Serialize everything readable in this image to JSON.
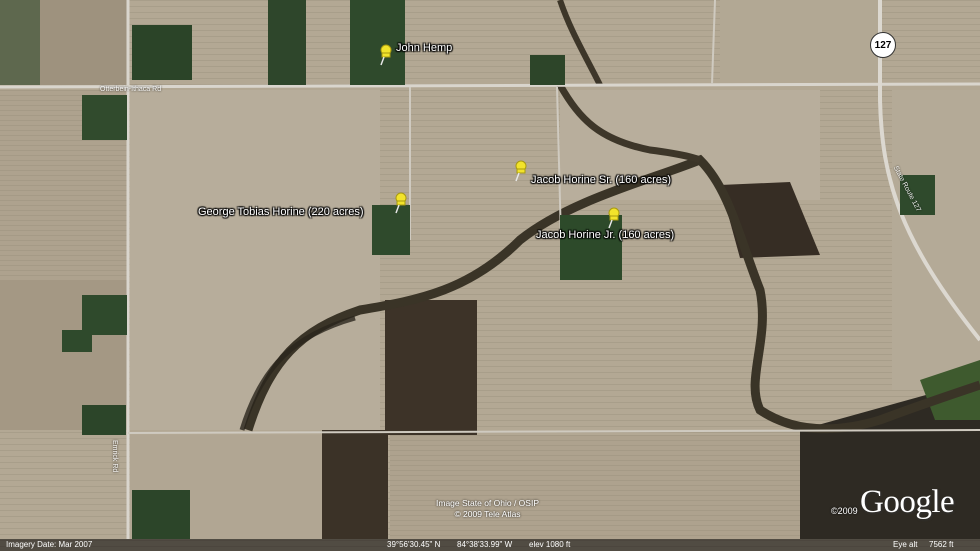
{
  "markers": [
    {
      "label": "John Hemp"
    },
    {
      "label": "Jacob Horine Sr. (160 acres)"
    },
    {
      "label": "George Tobias Horine (220 acres)"
    },
    {
      "label": "Jacob Horine Jr. (160 acres)"
    }
  ],
  "roads": {
    "highway_shield": "127",
    "road_a": "Otterbein-Ithaca Rd",
    "road_b": "Emrick Rd",
    "road_c": "State Route 127"
  },
  "credits": {
    "line1": "Image State of Ohio / OSIP",
    "line2": "© 2009 Tele Atlas",
    "logo": "Google",
    "copyright": "©2009"
  },
  "status": {
    "imagery_date": "Imagery Date: Mar 2007",
    "lat": "39°56'30.45\" N",
    "lon": "84°38'33.99\" W",
    "elev": "elev 1080 ft",
    "eye_alt_label": "Eye alt",
    "eye_alt": "7562 ft"
  },
  "colors": {
    "field": "#b5aa98",
    "field_dark": "#4a3f33",
    "road": "#d8d4cc",
    "trees": "#3a3529",
    "yard": "#2f4a2c",
    "pin": "#f2e32b"
  }
}
